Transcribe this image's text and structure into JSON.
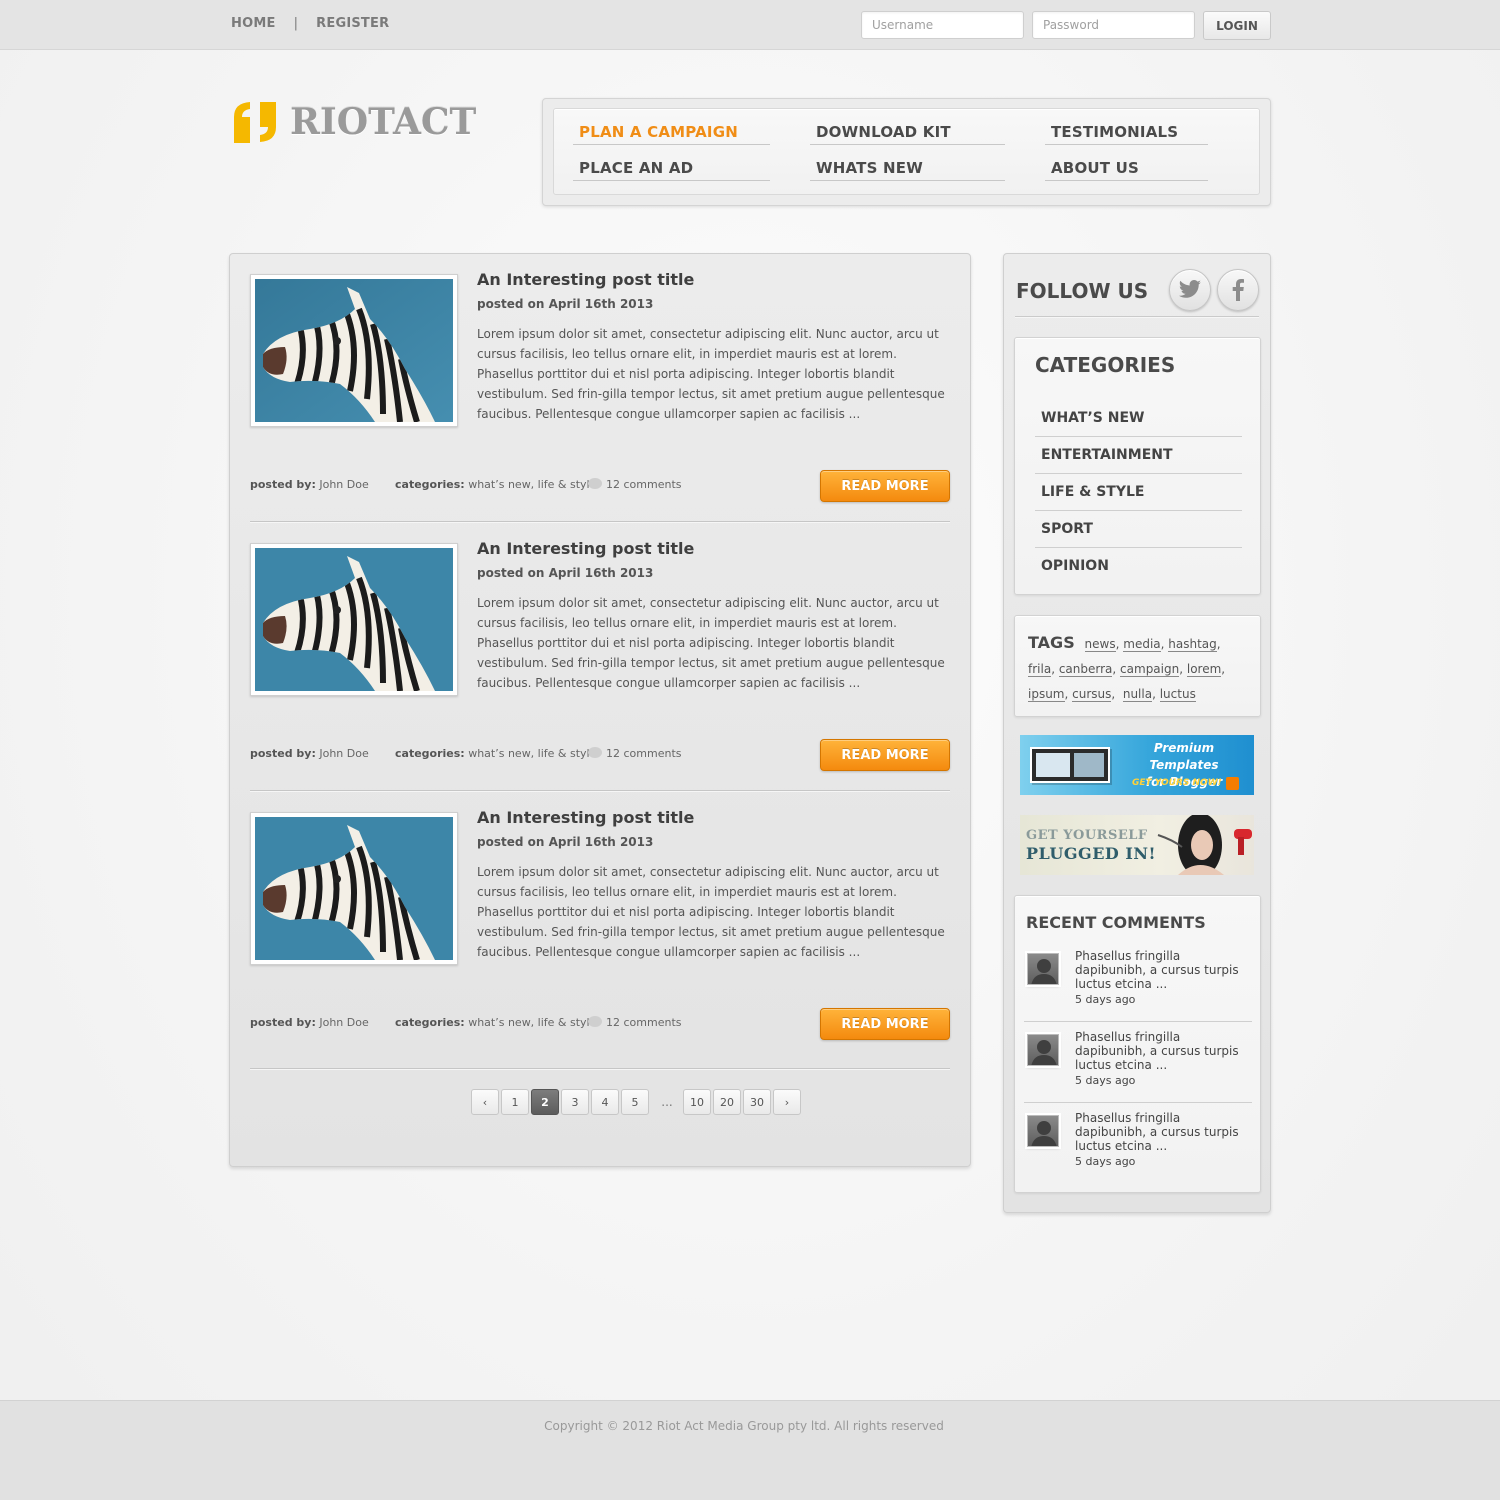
{
  "topbar": {
    "links": [
      "HOME",
      "REGISTER"
    ],
    "separator": "|",
    "username_placeholder": "Username",
    "password_placeholder": "Password",
    "login_label": "LOGIN"
  },
  "brand": {
    "name": "RIOTACT",
    "accent_color": "#f5b800"
  },
  "nav": {
    "items": [
      {
        "label": "PLAN A CAMPAIGN"
      },
      {
        "label": "DOWNLOAD KIT"
      },
      {
        "label": "TESTIMONIALS"
      },
      {
        "label": "PLACE AN AD"
      },
      {
        "label": "WHATS NEW"
      },
      {
        "label": "ABOUT US"
      }
    ],
    "active_color": "#f08d16"
  },
  "posts": [
    {
      "title": "An Interesting post title",
      "date": "posted on April 16th 2013",
      "body": "Lorem ipsum dolor sit amet, consectetur adipiscing elit. Nunc auctor, arcu ut cursus facilisis, leo tellus ornare elit, in imperdiet mauris est at lorem. Phasellus porttitor dui et nisl porta adipiscing. Integer lobortis blandit vestibulum. Sed frin-gilla tempor lectus, sit amet pretium augue pellentesque faucibus. Pellentesque congue ullamcorper sapien ac facilisis ...",
      "posted_by_label": "posted by:",
      "author": "John Doe",
      "categories_label": "categories:",
      "categories": "what’s new, life & style",
      "comments": "12 comments",
      "read_more": "READ MORE"
    },
    {
      "title": "An Interesting post title",
      "date": "posted on April 16th 2013",
      "body": "Lorem ipsum dolor sit amet, consectetur adipiscing elit. Nunc auctor, arcu ut cursus facilisis, leo tellus ornare elit, in imperdiet mauris est at lorem. Phasellus porttitor dui et nisl porta adipiscing. Integer lobortis blandit vestibulum. Sed frin-gilla tempor lectus, sit amet pretium augue pellentesque faucibus. Pellentesque congue ullamcorper sapien ac facilisis ...",
      "posted_by_label": "posted by:",
      "author": "John Doe",
      "categories_label": "categories:",
      "categories": "what’s new, life & style",
      "comments": "12 comments",
      "read_more": "READ MORE"
    },
    {
      "title": "An Interesting post title",
      "date": "posted on April 16th 2013",
      "body": "Lorem ipsum dolor sit amet, consectetur adipiscing elit. Nunc auctor, arcu ut cursus facilisis, leo tellus ornare elit, in imperdiet mauris est at lorem. Phasellus porttitor dui et nisl porta adipiscing. Integer lobortis blandit vestibulum. Sed frin-gilla tempor lectus, sit amet pretium augue pellentesque faucibus. Pellentesque congue ullamcorper sapien ac facilisis ...",
      "posted_by_label": "posted by:",
      "author": "John Doe",
      "categories_label": "categories:",
      "categories": "what’s new, life & style",
      "comments": "12 comments",
      "read_more": "READ MORE"
    }
  ],
  "pagination": {
    "prev": "‹",
    "pages": [
      "1",
      "2",
      "3",
      "4",
      "5"
    ],
    "ellipsis": "...",
    "more_pages": [
      "10",
      "20",
      "30"
    ],
    "next": "›",
    "current": "2"
  },
  "sidebar": {
    "follow_title": "FOLLOW US",
    "social_icons": [
      "twitter-icon",
      "facebook-icon"
    ],
    "categories_title": "CATEGORIES",
    "categories": [
      "WHAT’S NEW",
      "ENTERTAINMENT",
      "LIFE & STYLE",
      "SPORT",
      "OPINION"
    ],
    "tags_title": "TAGS",
    "tags": [
      "news",
      "media",
      "hashtag",
      "frila",
      "canberra",
      "campaign",
      "lorem",
      "ipsum",
      "cursus",
      "nulla",
      "luctus"
    ],
    "banner1": {
      "line1": "Premium Templates",
      "line2": "for Blogger",
      "cta": "GET YOURS NOW!"
    },
    "banner2": {
      "line1": "GET YOURSELF",
      "line2": "PLUGGED IN!"
    },
    "recent_title": "RECENT COMMENTS",
    "recent_comments": [
      {
        "text": "Phasellus fringilla dapibunibh, a cursus turpis luctus etcina ...",
        "time": "5 days ago"
      },
      {
        "text": "Phasellus fringilla dapibunibh, a cursus turpis luctus etcina ...",
        "time": "5 days ago"
      },
      {
        "text": "Phasellus fringilla dapibunibh, a cursus turpis luctus etcina ...",
        "time": "5 days ago"
      }
    ]
  },
  "footer": {
    "copyright": "Copyright © 2012 Riot Act Media Group pty ltd. All rights reserved"
  }
}
